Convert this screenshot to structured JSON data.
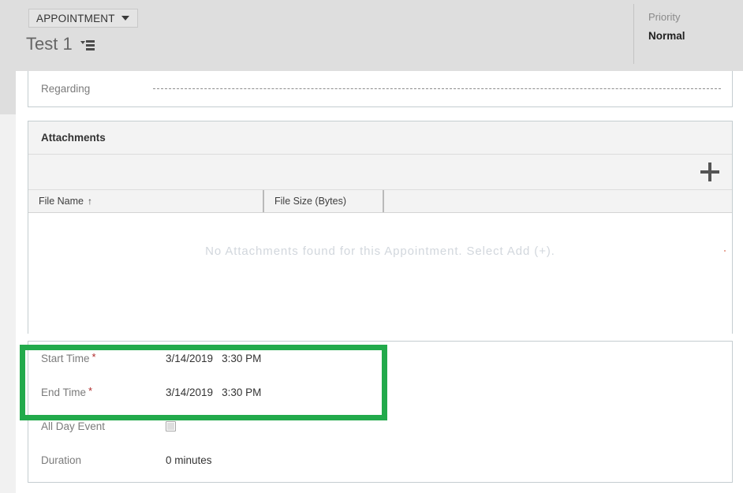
{
  "header": {
    "entity_chip_label": "APPOINTMENT",
    "entity_chip_icon": "chevron-down-icon",
    "record_title": "Test 1",
    "record_title_icon": "filter-list-icon",
    "priority_label": "Priority",
    "priority_value": "Normal"
  },
  "regarding": {
    "label": "Regarding",
    "value": ""
  },
  "attachments": {
    "section_title": "Attachments",
    "add_button_icon": "plus-icon",
    "add_button_label": "+",
    "columns": [
      {
        "label": "File Name",
        "sort_indicator": "↑"
      },
      {
        "label": "File Size (Bytes)",
        "sort_indicator": ""
      }
    ],
    "empty_message": "No Attachments found for this Appointment. Select Add (+).",
    "rows": []
  },
  "schedule": {
    "rows": [
      {
        "label": "Start Time",
        "required": "*",
        "date": "3/14/2019",
        "time": "3:30 PM"
      },
      {
        "label": "End Time",
        "required": "*",
        "date": "3/14/2019",
        "time": "3:30 PM"
      }
    ],
    "all_day_event": {
      "label": "All Day Event",
      "checked": false
    },
    "duration": {
      "label": "Duration",
      "value": "0 minutes"
    }
  },
  "annotation": {
    "highlight_color": "#22aa4b",
    "highlight_target": "start-and-end-time-fields"
  },
  "colors": {
    "header_band": "#dedede",
    "section_border": "#c4cdd0",
    "grid_header_bg": "#f3f3f3",
    "required_star": "#b02a2a",
    "empty_text": "#d2d7dd"
  }
}
